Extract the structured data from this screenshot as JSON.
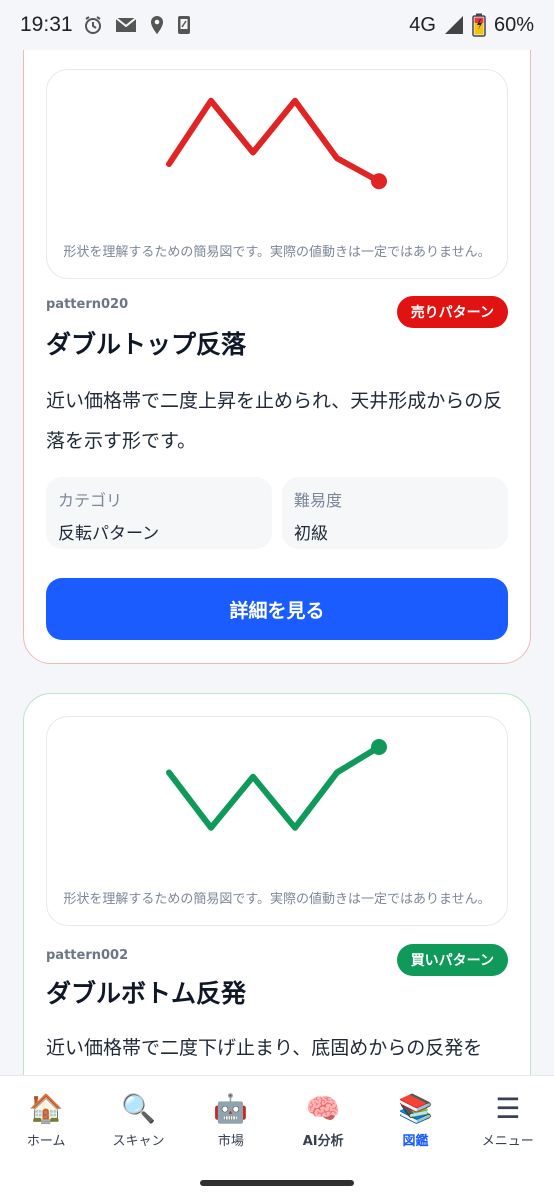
{
  "status_bar": {
    "time": "19:31",
    "network": "4G",
    "battery": "60%",
    "icons": [
      "alarm-icon",
      "mail-icon",
      "location-icon",
      "phone-icon",
      "signal-icon",
      "battery-charging-icon"
    ]
  },
  "cards": [
    {
      "chart_note": "形状を理解するための簡易図です。実際の値動きは一定ではありません。",
      "pattern_id": "pattern020",
      "badge": "売りパターン",
      "title": "ダブルトップ反落",
      "description": "近い価格帯で二度上昇を止められ、天井形成からの反落を示す形です。",
      "category_label": "カテゴリ",
      "category_value": "反転パターン",
      "difficulty_label": "難易度",
      "difficulty_value": "初級",
      "button_label": "詳細を見る",
      "line_color": "#e02424",
      "shape": [
        0.6,
        0.05,
        0.5,
        0.05,
        0.55,
        0.75
      ]
    },
    {
      "chart_note": "形状を理解するための簡易図です。実際の値動きは一定ではありません。",
      "pattern_id": "pattern002",
      "badge": "買いパターン",
      "title": "ダブルボトム反発",
      "description": "近い価格帯で二度下げ止まり、底固めからの反発を",
      "line_color": "#0f9a5a",
      "shape": [
        0.3,
        0.95,
        0.35,
        0.95,
        0.3,
        0.0
      ]
    }
  ],
  "nav": {
    "items": [
      {
        "icon": "🏠",
        "icon_name": "home-icon",
        "label": "ホーム"
      },
      {
        "icon": "🔍",
        "icon_name": "search-icon",
        "label": "スキャン"
      },
      {
        "icon": "🤖",
        "icon_name": "robot-icon",
        "label": "市場"
      },
      {
        "icon": "🧠",
        "icon_name": "brain-icon",
        "label": "AI分析"
      },
      {
        "icon": "📚",
        "icon_name": "books-icon",
        "label": "図鑑"
      },
      {
        "icon": "☰",
        "icon_name": "menu-icon",
        "label": "メニュー"
      }
    ],
    "active_index": 4
  }
}
